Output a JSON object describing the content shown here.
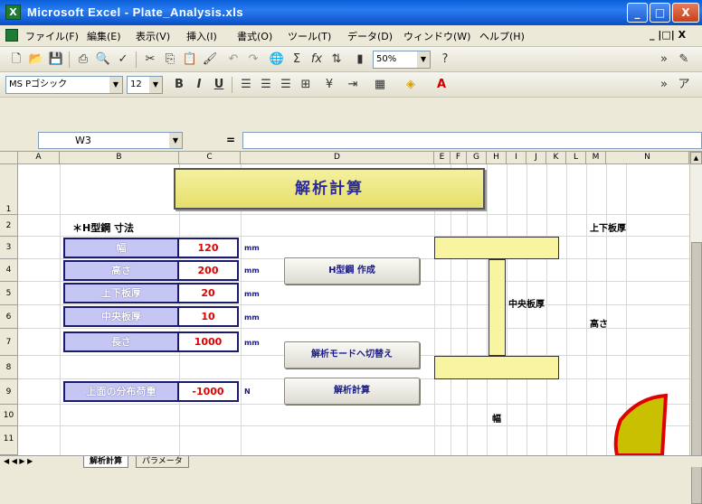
{
  "window": {
    "title": "Microsoft Excel - Plate_Analysis.xls",
    "app_icon_glyph": "X",
    "min_glyph": "_",
    "max_glyph": "□",
    "close_glyph": "X"
  },
  "menu": {
    "items": [
      "ファイル(F)",
      "編集(E)",
      "表示(V)",
      "挿入(I)",
      "書式(O)",
      "ツール(T)",
      "データ(D)",
      "ウィンドウ(W)",
      "ヘルプ(H)"
    ],
    "doc_controls": "_ |□| X"
  },
  "toolbar": {
    "zoom": "50%",
    "font_name": "MS Pゴシック",
    "font_size": "12",
    "bold": "B",
    "italic": "I",
    "underline": "U"
  },
  "formula_bar": {
    "name_box": "W3",
    "fx_label": "="
  },
  "grid": {
    "columns": [
      "A",
      "B",
      "C",
      "D",
      "E",
      "F",
      "G",
      "H",
      "I",
      "J",
      "K",
      "L",
      "M",
      "N"
    ],
    "rows": [
      "1",
      "2",
      "3",
      "4",
      "5",
      "6",
      "7",
      "8",
      "9",
      "10",
      "11"
    ]
  },
  "sheet": {
    "title_banner": "解析計算",
    "section_title": "＊H型鋼 寸法",
    "params": [
      {
        "label": "幅",
        "value": "120",
        "unit": "mm"
      },
      {
        "label": "高さ",
        "value": "200",
        "unit": "mm"
      },
      {
        "label": "上下板厚",
        "value": "20",
        "unit": "mm"
      },
      {
        "label": "中央板厚",
        "value": "10",
        "unit": "mm"
      },
      {
        "label": "長さ",
        "value": "1000",
        "unit": "mm"
      }
    ],
    "load": {
      "label": "上面の分布荷重",
      "value": "-1000",
      "unit": "N"
    },
    "buttons": {
      "create": "H型鋼 作成",
      "switch_mode": "解析モードへ切替え",
      "calculate": "解析計算"
    },
    "diagram_labels": {
      "flange_thickness": "上下板厚",
      "web_thickness": "中央板厚",
      "height": "高さ",
      "width": "幅"
    }
  },
  "sheet_tabs": {
    "active": "解析計算",
    "other": "パラメータ",
    "nav_glyphs": "◀ ◀ ▶ ▶"
  }
}
